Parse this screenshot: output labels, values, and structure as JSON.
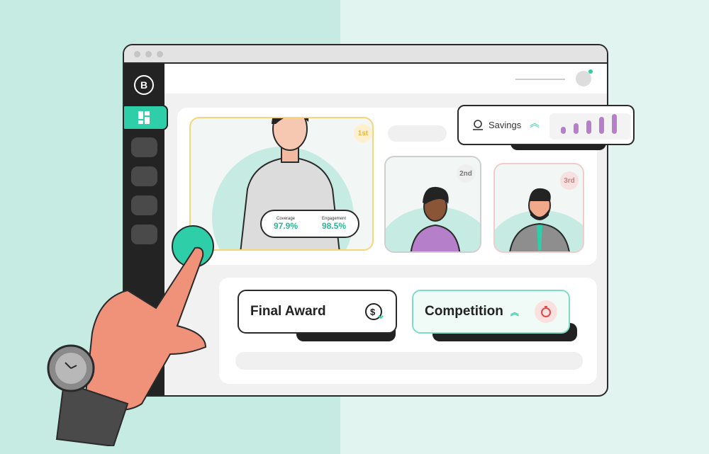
{
  "logo": {
    "letter": "B"
  },
  "podium": [
    {
      "rank": "1st",
      "badge_color": "#f5b63a"
    },
    {
      "rank": "2nd",
      "badge_color": "#8a8a8a"
    },
    {
      "rank": "3rd",
      "badge_color": "#c88080"
    }
  ],
  "stats": {
    "coverage_label": "Coverage",
    "coverage_value": "97.9%",
    "engagement_label": "Engagement",
    "engagement_value": "98.5%"
  },
  "savings": {
    "label": "Savings",
    "icon": "money-hand-icon",
    "trend": "chevron-double-up-icon",
    "bars": [
      1,
      2,
      3,
      4,
      5
    ]
  },
  "cards": {
    "final_award": "Final Award",
    "final_award_icon": "dollar-down-icon",
    "competition": "Competition",
    "competition_icon": "stopwatch-icon"
  },
  "colors": {
    "accent": "#2ecfa8",
    "purple": "#b57fc9",
    "dark": "#232323"
  }
}
